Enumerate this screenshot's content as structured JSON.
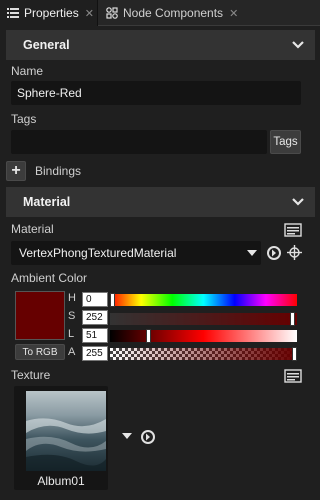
{
  "tabs": [
    {
      "label": "Properties",
      "icon": "list-icon",
      "active": true
    },
    {
      "label": "Node Components",
      "icon": "components-icon",
      "active": false
    }
  ],
  "general": {
    "title": "General",
    "name_label": "Name",
    "name_value": "Sphere-Red",
    "tags_label": "Tags",
    "tags_value": "",
    "tags_button": "Tags",
    "bindings_label": "Bindings"
  },
  "material": {
    "title": "Material",
    "material_label": "Material",
    "material_value": "VertexPhongTexturedMaterial",
    "ambient_label": "Ambient Color",
    "swatch_color": "#660000",
    "to_rgb_label": "To RGB",
    "channels": [
      {
        "label": "H",
        "value": "0",
        "fraction": 0.0
      },
      {
        "label": "S",
        "value": "252",
        "fraction": 0.988
      },
      {
        "label": "L",
        "value": "51",
        "fraction": 0.2
      },
      {
        "label": "A",
        "value": "255",
        "fraction": 1.0
      }
    ],
    "texture_label": "Texture",
    "texture_name": "Album01"
  },
  "colors": {
    "background": "#1f1f1f",
    "section": "#333333",
    "field": "#141414"
  }
}
